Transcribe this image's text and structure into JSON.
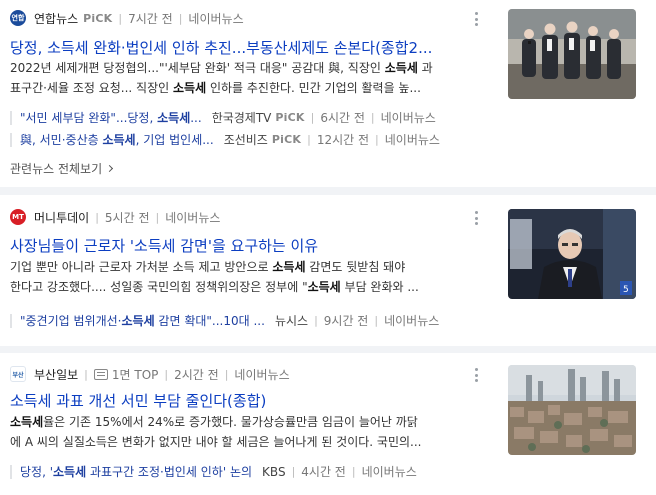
{
  "articles": [
    {
      "press": "연합뉴스",
      "press_logo": "연합",
      "pick": "PiCK",
      "time": "7시간 전",
      "portal": "네이버뉴스",
      "title": "당정, 소득세 완화·법인세 인하 추진...부동산세제도 손본다(종합2...",
      "desc_line1_a": "2022년 세제개편 당정협의...\"'세부담 완화' 적극 대응\" 공감대 與, 직장인 ",
      "desc_line1_b": "소득세",
      "desc_line1_c": " 과",
      "desc_line2_a": "표구간·세율 조정 요청... 직장인 ",
      "desc_line2_b": "소득세",
      "desc_line2_c": " 인하를 추진한다. 민간 기업의 활력을 높...",
      "related": [
        {
          "title_a": "\"서민 세부담 완화\"...당정, ",
          "title_b": "소득세",
          "title_c": "...",
          "press": "한국경제TV",
          "pick": "PiCK",
          "time": "6시간 전",
          "portal": "네이버뉴스"
        },
        {
          "title_a": "與, 서민·중산층 ",
          "title_b": "소득세",
          "title_c": ", 기업 법인세...",
          "press": "조선비즈",
          "pick": "PiCK",
          "time": "12시간 전",
          "portal": "네이버뉴스"
        }
      ],
      "all_related": "관련뉴스 전체보기"
    },
    {
      "press": "머니투데이",
      "press_logo": "MT",
      "time": "5시간 전",
      "portal": "네이버뉴스",
      "title": "사장님들이 근로자 '소득세 감면'을 요구하는 이유",
      "desc_line1_a": "기업 뿐만 아니라 근로자 가처분 소득 제고 방안으로 ",
      "desc_line1_b": "소득세",
      "desc_line1_c": " 감면도 뒷받침 돼야",
      "desc_line2_a": "한다고 강조했다.... 성일종 국민의힘 정책위의장은 정부에 \"",
      "desc_line2_b": "소득세",
      "desc_line2_c": " 부담 완화와 ...",
      "related": [
        {
          "title_a": "\"중견기업 범위개선·",
          "title_b": "소득세",
          "title_c": " 감면 확대\"...10대 ...",
          "press": "뉴시스",
          "time": "9시간 전",
          "portal": "네이버뉴스"
        }
      ]
    },
    {
      "press": "부산일보",
      "press_logo": "부산",
      "paper_page": "1면 TOP",
      "time": "2시간 전",
      "portal": "네이버뉴스",
      "title": "소득세 과표 개선 서민 부담 줄인다(종합)",
      "desc_line1_a": "",
      "desc_line1_b": "소득세",
      "desc_line1_c": "율은 기존 15%에서 24%로 증가했다. 물가상승률만큼 임금이 늘어난 까닭",
      "desc_line2_a": "에 A 씨의 실질소득은 변화가 없지만 내야 할 세금은 늘어나게 된 것이다. 국민의...",
      "desc_line2_b": "",
      "desc_line2_c": "",
      "related": [
        {
          "title_a": "당정, '",
          "title_b": "소득세",
          "title_c": " 과표구간 조정·법인세 인하' 논의",
          "press": "KBS",
          "time": "4시간 전",
          "portal": "네이버뉴스"
        }
      ]
    }
  ],
  "icons": {
    "more": "more-vertical-icon",
    "chevron": "chevron-right-icon",
    "paper": "newspaper-icon"
  },
  "colors": {
    "title_link": "#0c3ec1",
    "related_link": "#1d3fa0",
    "pick_gray": "#888888",
    "separator": "#f1f3f6"
  }
}
